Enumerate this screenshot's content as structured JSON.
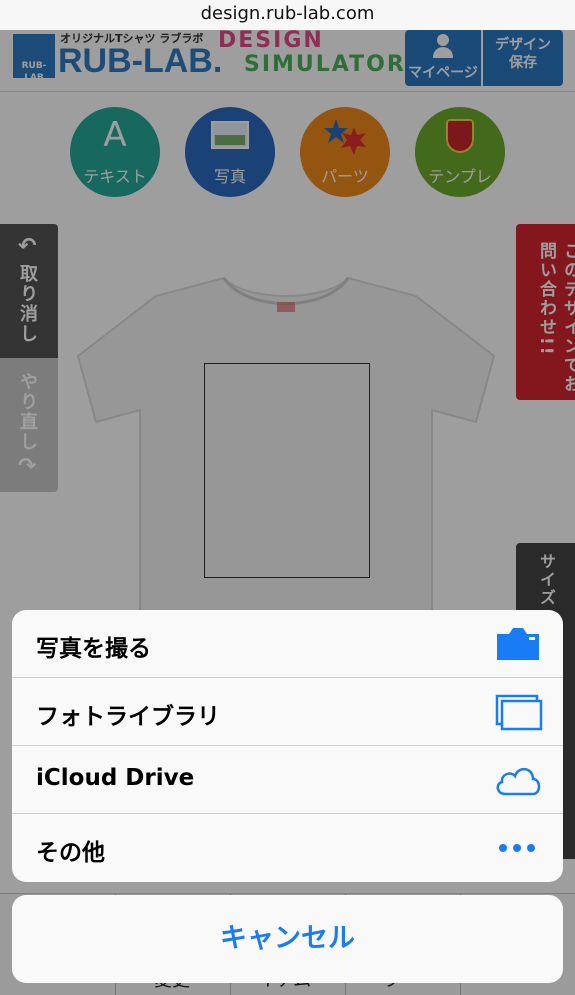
{
  "browser": {
    "url": "design.rub-lab.com"
  },
  "header": {
    "logo_tag": "オリジナルTシャツ ラブラボ",
    "logo_box_text": "RUB-LAB",
    "logo_name": "RUB-LAB.",
    "sim_line1": "DESIGN",
    "sim_line2": "SIMULATOR",
    "mypage_label": "マイページ",
    "save_label_1": "デザイン",
    "save_label_2": "保存"
  },
  "tools": [
    {
      "label": "テキスト",
      "icon": "A"
    },
    {
      "label": "写真"
    },
    {
      "label": "パーツ"
    },
    {
      "label": "テンプレ"
    }
  ],
  "side": {
    "undo": "取り消し",
    "redo": "やり直し",
    "contact": "このデザインでお問い合わせ!!",
    "size": "サイズ"
  },
  "bottombar": {
    "labels": [
      "変更",
      "イテム",
      "ラー"
    ]
  },
  "action_sheet": {
    "items": [
      {
        "label": "写真を撮る",
        "icon": "camera-icon"
      },
      {
        "label": "フォトライブラリ",
        "icon": "photo-library-icon"
      },
      {
        "label": "iCloud Drive",
        "icon": "icloud-icon"
      },
      {
        "label": "その他",
        "icon": "more-icon"
      }
    ],
    "cancel": "キャンセル"
  },
  "colors": {
    "accent": "#1a7cf5",
    "brand": "#2a78c2",
    "contact": "#d6262f"
  }
}
